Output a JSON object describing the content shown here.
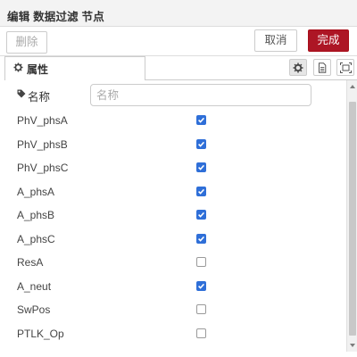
{
  "dialog": {
    "title": "编辑 数据过滤 节点"
  },
  "toolbar": {
    "delete_label": "删除",
    "cancel_label": "取消",
    "done_label": "完成"
  },
  "tabs": {
    "properties_label": "属性",
    "properties_icon": "gear-icon",
    "right_icons": [
      "gear-icon",
      "document-icon",
      "expand-icon"
    ]
  },
  "form": {
    "name_label": "名称",
    "name_icon": "tag-icon",
    "name_placeholder": "名称",
    "name_value": ""
  },
  "fields": [
    {
      "label": "PhV_phsA",
      "checked": true
    },
    {
      "label": "PhV_phsB",
      "checked": true
    },
    {
      "label": "PhV_phsC",
      "checked": true
    },
    {
      "label": "A_phsA",
      "checked": true
    },
    {
      "label": "A_phsB",
      "checked": true
    },
    {
      "label": "A_phsC",
      "checked": true
    },
    {
      "label": "ResA",
      "checked": false
    },
    {
      "label": "A_neut",
      "checked": true
    },
    {
      "label": "SwPos",
      "checked": false
    },
    {
      "label": "PTLK_Op",
      "checked": false
    }
  ],
  "colors": {
    "accent": "#ad1625",
    "checkbox": "#2f6fd8"
  }
}
